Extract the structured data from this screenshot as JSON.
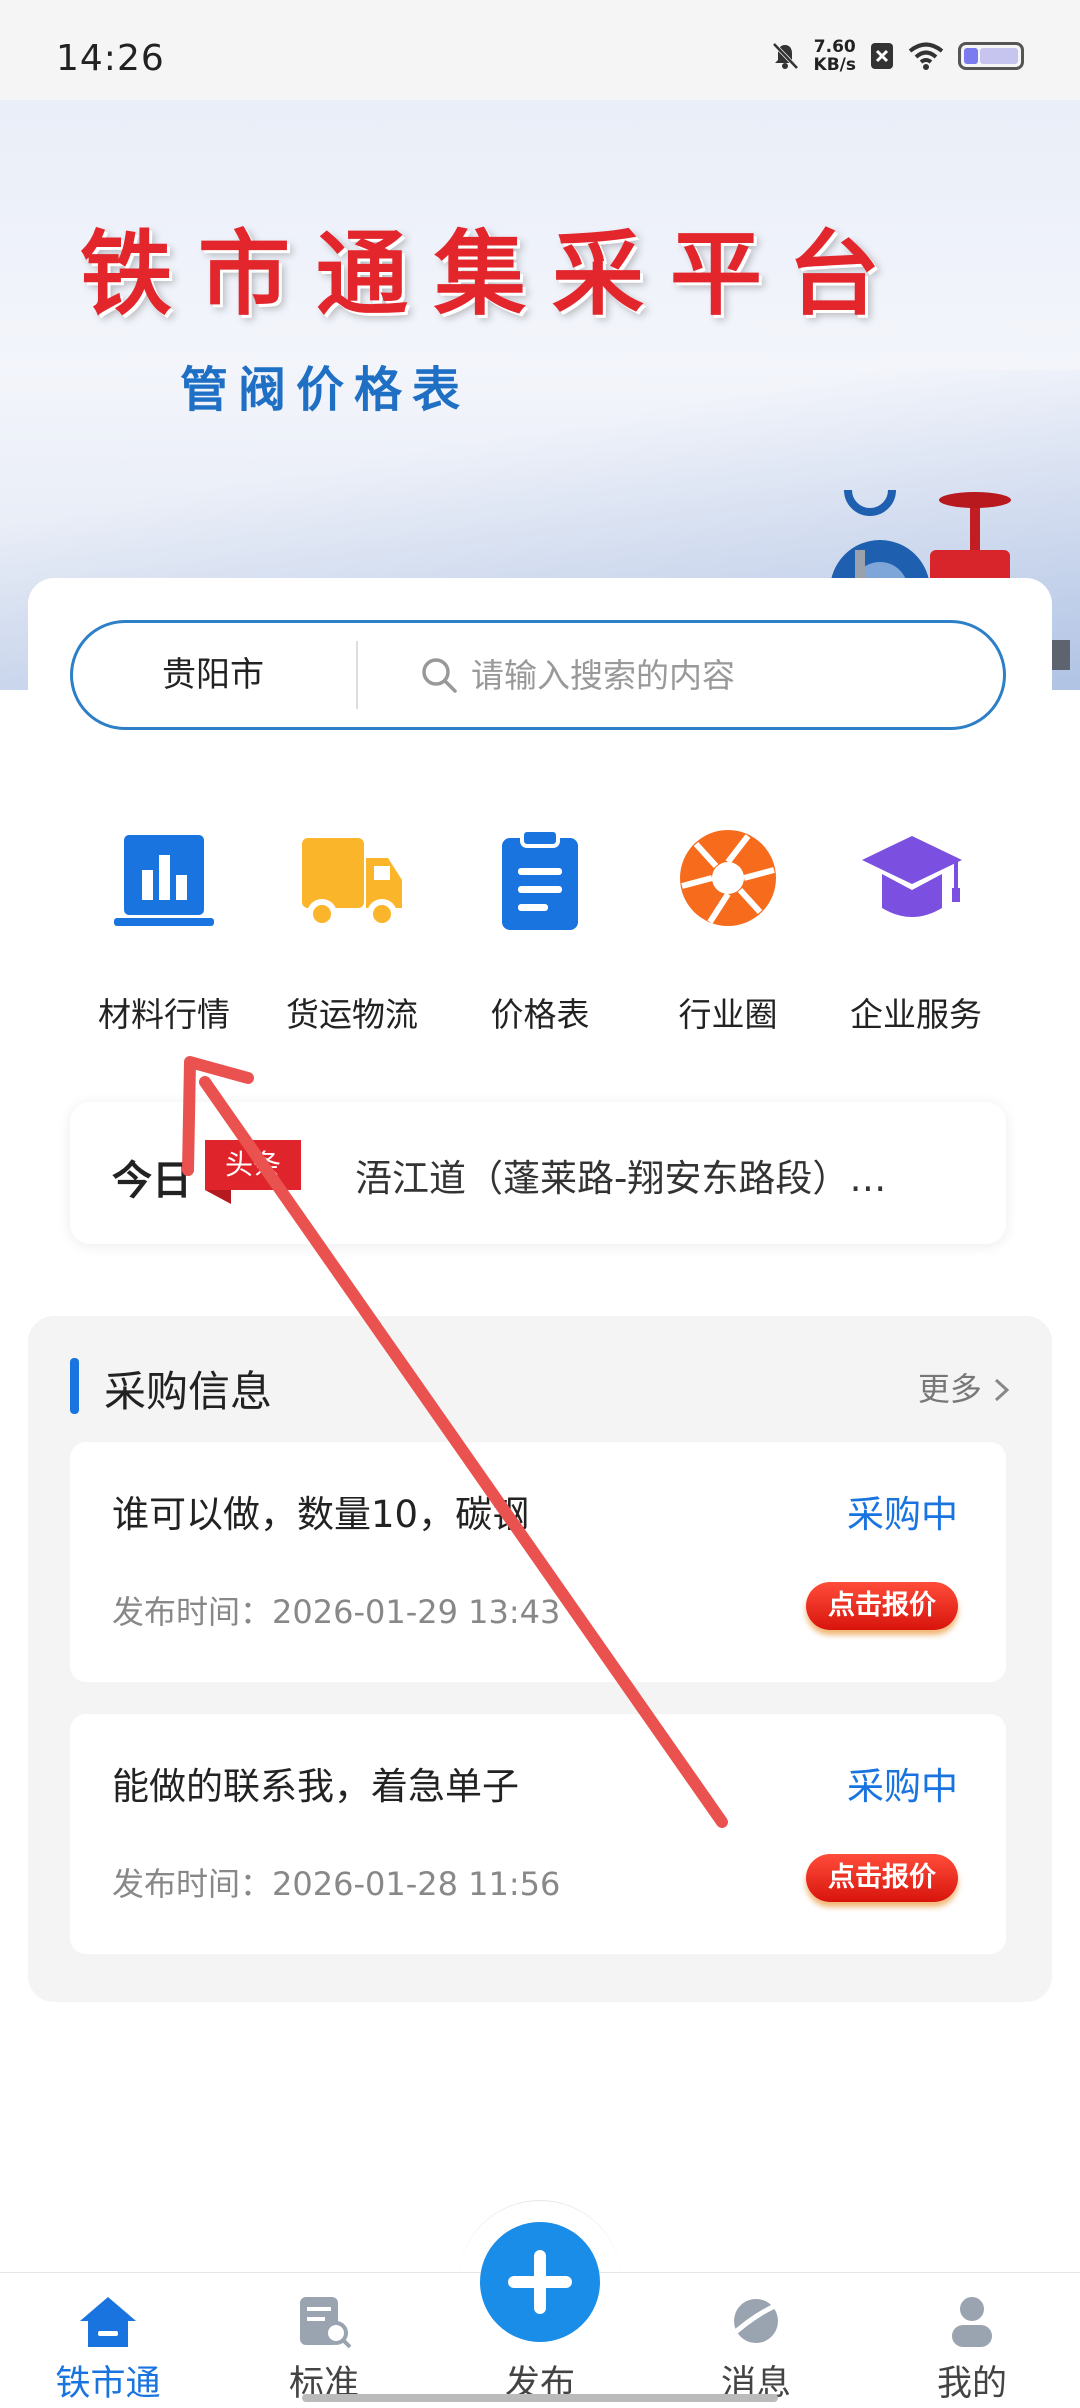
{
  "status_bar": {
    "time": "14:26",
    "net_speed_value": "7.60",
    "net_speed_unit": "KB/s",
    "icons": [
      "mute-icon",
      "no-sim-icon",
      "wifi-icon",
      "battery-icon"
    ]
  },
  "banner": {
    "title": "铁市通集采平台",
    "subtitle": "管阀价格表"
  },
  "search": {
    "city": "贵阳市",
    "placeholder": "请输入搜索的内容"
  },
  "quick_menu": [
    {
      "label": "材料行情",
      "icon": "chart-board-icon",
      "color": "#1a74e0"
    },
    {
      "label": "货运物流",
      "icon": "truck-icon",
      "color": "#fbb52b"
    },
    {
      "label": "价格表",
      "icon": "clipboard-icon",
      "color": "#1a74e0"
    },
    {
      "label": "行业圈",
      "icon": "aperture-icon",
      "color": "#f76b1c"
    },
    {
      "label": "企业服务",
      "icon": "graduation-cap-icon",
      "color": "#7b4fe0"
    }
  ],
  "headline": {
    "today": "今日",
    "badge": "头条",
    "text": "浯江道（蓬莱路-翔安东路段）…"
  },
  "purchase": {
    "title": "采购信息",
    "more": "更多",
    "items": [
      {
        "title": "谁可以做，数量10，碳钢",
        "time": "发布时间：2026-01-29 13:43",
        "status": "采购中",
        "button": "点击报价"
      },
      {
        "title": "能做的联系我，着急单子",
        "time": "发布时间：2026-01-28 11:56",
        "status": "采购中",
        "button": "点击报价"
      }
    ]
  },
  "bottom_nav": [
    {
      "label": "铁市通",
      "icon": "home-icon",
      "active": true
    },
    {
      "label": "标准",
      "icon": "document-search-icon",
      "active": false
    },
    {
      "label": "发布",
      "icon": "plus-icon",
      "active": false
    },
    {
      "label": "消息",
      "icon": "planet-icon",
      "active": false
    },
    {
      "label": "我的",
      "icon": "user-icon",
      "active": false
    }
  ],
  "colors": {
    "accent": "#1a74e0",
    "badge_red": "#e0242b",
    "quote_button": "#d8140d"
  }
}
